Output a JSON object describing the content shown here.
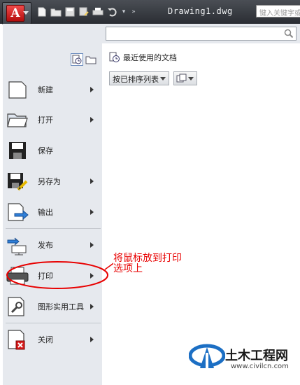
{
  "titlebar": {
    "app_letter": "A",
    "doc_title": "Drawing1.dwg",
    "search_placeholder": "键入关键字或短语"
  },
  "view_toggle": [
    {
      "name": "recent-view-icon",
      "active": true
    },
    {
      "name": "open-folder-view-icon",
      "active": false
    }
  ],
  "menu_items": [
    {
      "label": "新建",
      "has_submenu": true
    },
    {
      "label": "打开",
      "has_submenu": true
    },
    {
      "label": "保存",
      "has_submenu": false
    },
    {
      "label": "另存为",
      "has_submenu": true
    },
    {
      "label": "输出",
      "has_submenu": true
    },
    {
      "label": "发布",
      "has_submenu": true
    },
    {
      "label": "打印",
      "has_submenu": true
    },
    {
      "label": "图形实用工具",
      "has_submenu": true
    },
    {
      "label": "关闭",
      "has_submenu": true
    }
  ],
  "recent": {
    "header": "最近使用的文档",
    "sort_selected": "按已排序列表"
  },
  "annotation": {
    "line1": "将鼠标放到打印",
    "line2": "选项上",
    "color": "#e80000"
  },
  "watermark": {
    "name": "土木工程网",
    "url": "www.civilcn.com"
  }
}
